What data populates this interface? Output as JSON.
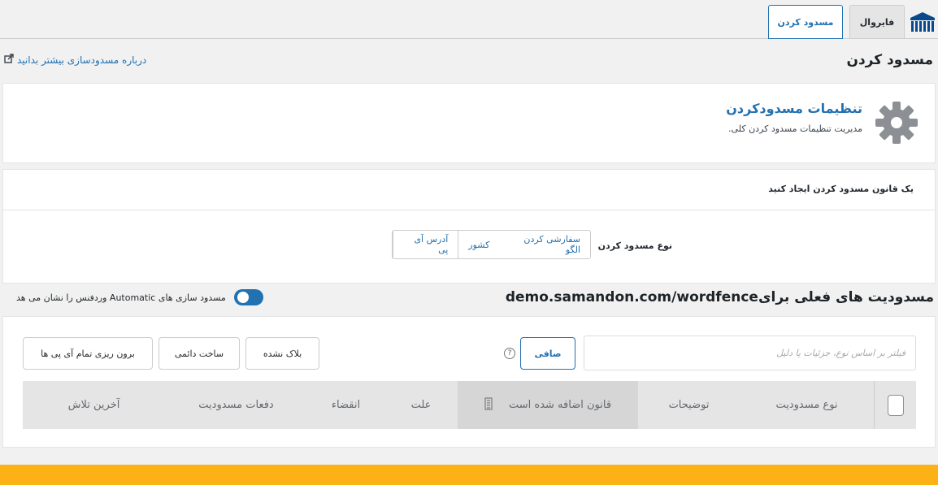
{
  "tabs": {
    "firewall": "فایروال",
    "blocking": "مسدود کردن"
  },
  "header": {
    "title": "مسدود کردن",
    "learn_more": "درباره مسدودسازی بیشتر بدانید"
  },
  "settings_card": {
    "title": "تنظیمات مسدودکردن",
    "subtitle": "مدیریت تنظیمات مسدود کردن کلی."
  },
  "create_rule": {
    "heading": "یک قانون مسدود کردن ایجاد کنید",
    "type_label": "نوع مسدود کردن",
    "types": [
      "آدرس آی پی",
      "کشور",
      "سفارشی کردن الگو"
    ]
  },
  "active_blocks": {
    "title": "مسدودیت های فعلی برای",
    "site": "demo.samandon.com/wordfence",
    "toggle_label": "مسدود سازی های Automatic وردفنس را نشان می هد",
    "toggle_on": true
  },
  "toolbar": {
    "filter_placeholder": "فیلتر بر اساس نوع، جزئیات یا دلیل",
    "filter_button": "صافی",
    "help": "?",
    "unblock": "بلاک نشده",
    "make_permanent": "ساخت دائمی",
    "export_all": "برون ریزی تمام آی پی ها"
  },
  "table": {
    "columns": [
      "نوع مسدودیت",
      "توضیحات",
      "قانون اضافه شده است",
      "علت",
      "انقضاء",
      "دفعات مسدودیت",
      "آخرین تلاش"
    ]
  },
  "colors": {
    "accent": "#2271b1",
    "footer_bar": "#fcb214"
  }
}
